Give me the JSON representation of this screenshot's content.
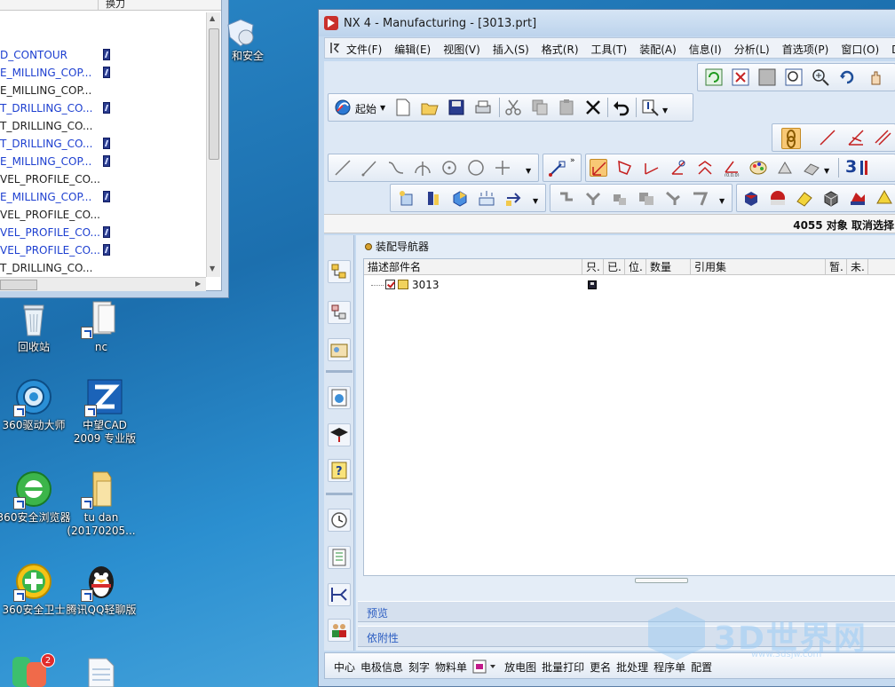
{
  "op_window": {
    "column_header": "换刀",
    "operations": [
      {
        "name": "D_CONTOUR",
        "style": "blue",
        "tool": true
      },
      {
        "name": "E_MILLING_COP...",
        "style": "blue",
        "tool": true
      },
      {
        "name": "E_MILLING_COP...",
        "style": "dark",
        "tool": false
      },
      {
        "name": "T_DRILLING_CO...",
        "style": "blue",
        "tool": true
      },
      {
        "name": "T_DRILLING_CO...",
        "style": "dark",
        "tool": false
      },
      {
        "name": "T_DRILLING_CO...",
        "style": "blue",
        "tool": true
      },
      {
        "name": "E_MILLING_COP...",
        "style": "blue",
        "tool": true
      },
      {
        "name": "VEL_PROFILE_CO...",
        "style": "dark",
        "tool": false
      },
      {
        "name": "E_MILLING_COP...",
        "style": "blue",
        "tool": true
      },
      {
        "name": "VEL_PROFILE_CO...",
        "style": "dark",
        "tool": false
      },
      {
        "name": "VEL_PROFILE_CO...",
        "style": "blue",
        "tool": true
      },
      {
        "name": "VEL_PROFILE_CO...",
        "style": "blue",
        "tool": true
      },
      {
        "name": "T_DRILLING_CO...",
        "style": "dark",
        "tool": false
      }
    ]
  },
  "desktop": {
    "partial_label": "和安全",
    "icons": [
      {
        "key": "recycle",
        "label": "回收站"
      },
      {
        "key": "nc",
        "label": "nc"
      },
      {
        "key": "driver",
        "label": "360驱动大师"
      },
      {
        "key": "zwcad",
        "label": "中望CAD 2009 专业版"
      },
      {
        "key": "browser",
        "label": "360安全浏览器"
      },
      {
        "key": "tudan",
        "label": "tu dan (20170205..."
      },
      {
        "key": "guard",
        "label": "360安全卫士"
      },
      {
        "key": "qq",
        "label": "腾讯QQ轻聊版"
      }
    ],
    "badge_count": "2"
  },
  "nx_window": {
    "title": "NX 4 - Manufacturing - [3013.prt]",
    "menu": [
      "文件(F)",
      "编辑(E)",
      "视图(V)",
      "插入(S)",
      "格式(R)",
      "工具(T)",
      "装配(A)",
      "信息(I)",
      "分析(L)",
      "首选项(P)",
      "窗口(O)",
      "D 帮"
    ],
    "start_label": "起始",
    "status_message": "4055 对象 取消选择",
    "text_button_3": "3",
    "navigator": {
      "title": "装配导航器",
      "columns": [
        "描述部件名",
        "只.",
        "已.",
        "位.",
        "数量",
        "引用集",
        "暂.",
        "未."
      ],
      "rows": [
        {
          "name": "3013"
        }
      ],
      "preview_label": "预览",
      "dependency_label": "依附性"
    },
    "bottom_toolbar": [
      "中心",
      "电极信息",
      "刻字",
      "物料单",
      "放电图",
      "批量打印",
      "更名",
      "批处理",
      "程序单",
      "配置"
    ]
  },
  "watermark": {
    "text": "3D世界网",
    "sub": "www.3dsjw.com"
  },
  "colors": {
    "accent_highlight": "#f8c875",
    "link_blue": "#1d3fd0",
    "section_label": "#2d5ec2"
  }
}
